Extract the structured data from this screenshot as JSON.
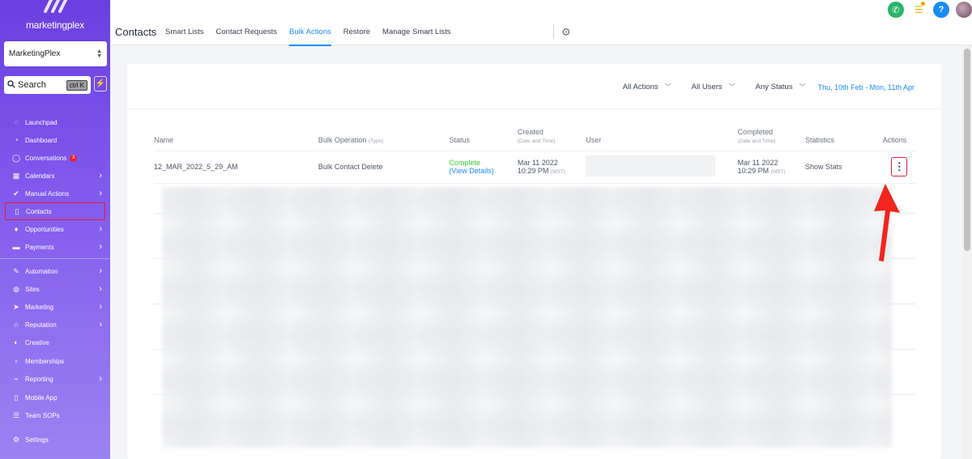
{
  "sidebar": {
    "logo_text": "marketingplex",
    "account_select": "MarketingPlex",
    "search_label": "Search",
    "search_shortcut": "ctrl K",
    "items": [
      {
        "label": "Launchpad",
        "icon": "rocket-icon"
      },
      {
        "label": "Dashboard",
        "icon": "dashboard-icon"
      },
      {
        "label": "Conversations",
        "icon": "chat-icon",
        "badge": "3"
      },
      {
        "label": "Calendars",
        "icon": "calendar-icon"
      },
      {
        "label": "Manual Actions",
        "icon": "check-circle-icon"
      },
      {
        "label": "Contacts",
        "icon": "contact-book-icon"
      },
      {
        "label": "Opportunities",
        "icon": "funnel-icon"
      },
      {
        "label": "Payments",
        "icon": "credit-card-icon"
      },
      {
        "label": "Automation",
        "icon": "automation-icon"
      },
      {
        "label": "Sites",
        "icon": "globe-icon"
      },
      {
        "label": "Marketing",
        "icon": "send-icon"
      },
      {
        "label": "Reputation",
        "icon": "star-icon"
      },
      {
        "label": "Creative",
        "icon": "palette-icon"
      },
      {
        "label": "Memberships",
        "icon": "medal-icon"
      },
      {
        "label": "Reporting",
        "icon": "chart-icon"
      },
      {
        "label": "Mobile App",
        "icon": "mobile-icon"
      },
      {
        "label": "Team SOPs",
        "icon": "list-icon"
      }
    ],
    "settings_label": "Settings"
  },
  "header": {
    "title": "Contacts",
    "tabs": [
      {
        "label": "Smart Lists"
      },
      {
        "label": "Contact Requests"
      },
      {
        "label": "Bulk Actions"
      },
      {
        "label": "Restore"
      },
      {
        "label": "Manage Smart Lists"
      }
    ],
    "active_tab": "Bulk Actions"
  },
  "filters": {
    "actions": "All Actions",
    "users": "All Users",
    "status": "Any Status",
    "date_range": "Thu, 10th Feb - Mon, 11th Apr"
  },
  "table": {
    "columns": {
      "name": "Name",
      "operation": "Bulk Operation",
      "operation_sub": "(Type)",
      "status": "Status",
      "created": "Created",
      "created_sub": "(Date and Time)",
      "user": "User",
      "completed": "Completed",
      "completed_sub": "(Date and Time)",
      "statistics": "Statistics",
      "actions": "Actions"
    },
    "rows": [
      {
        "name": "12_MAR_2022_5_29_AM",
        "operation": "Bulk Contact Delete",
        "status": "Complete",
        "status_link": "(View Details)",
        "created_date": "Mar 11 2022",
        "created_time": "10:29 PM",
        "created_tz": "(MST)",
        "completed_date": "Mar 11 2022",
        "completed_time": "10:29 PM",
        "completed_tz": "(MST)",
        "statistics": "Show Stats",
        "actions_icon": "⋮"
      }
    ]
  },
  "colors": {
    "accent": "#188bf6",
    "sidebar": "#7d55ec",
    "success": "#37ca37",
    "highlight": "#e21c3a"
  }
}
